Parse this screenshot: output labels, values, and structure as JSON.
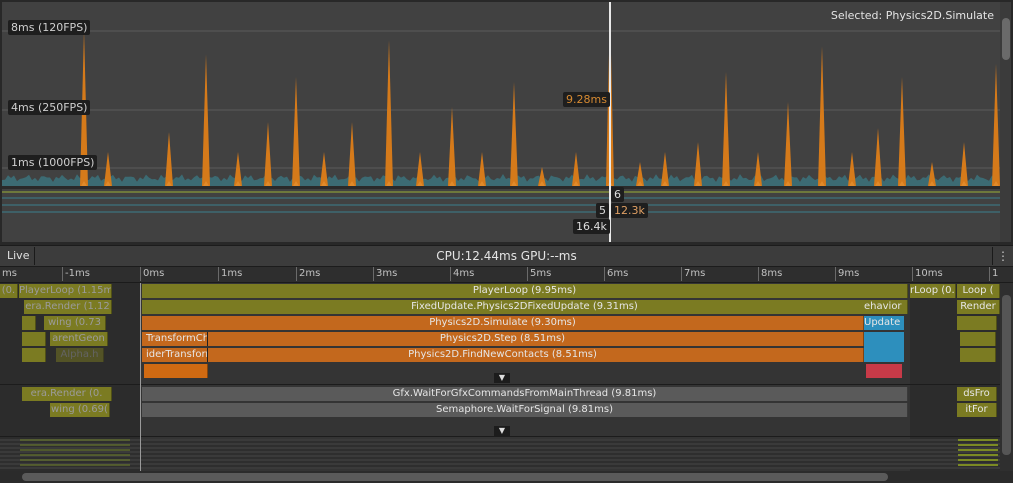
{
  "chart": {
    "selected_label": "Selected: Physics2D.Simulate",
    "fps_markers": [
      {
        "label": "8ms (120FPS)"
      },
      {
        "label": "4ms (250FPS)"
      },
      {
        "label": "1ms (1000FPS)"
      }
    ],
    "cursor_value": "9.28ms",
    "cursor_small_a": "6",
    "cursor_small_b": "5",
    "cursor_value_b": "12.3k",
    "cursor_value_c": "16.4k",
    "colors": {
      "spike": "#d57a1a",
      "baseline": "#3c6b73",
      "cursor": "#e8e8e8"
    }
  },
  "header": {
    "live_label": "Live",
    "cpu_gpu": "CPU:12.44ms   GPU:--ms",
    "menu_icon": "kebab-icon"
  },
  "ruler": {
    "ticks": [
      "ms",
      "-1ms",
      "0ms",
      "1ms",
      "2ms",
      "3ms",
      "4ms",
      "5ms",
      "6ms",
      "7ms",
      "8ms",
      "9ms",
      "10ms",
      "1"
    ]
  },
  "timeline": {
    "main_rows": [
      {
        "label": "PlayerLoop (9.95ms)"
      },
      {
        "label": "FixedUpdate.Physics2DFixedUpdate (9.31ms)"
      },
      {
        "label": "Physics2D.Simulate (9.30ms)"
      },
      {
        "label": "Physics2D.Step (8.51ms)"
      },
      {
        "label": "Physics2D.FindNewContacts (8.51ms)"
      }
    ],
    "left_labels": [
      "(0.",
      "PlayerLoop (1.15ms",
      "era.Render (1.12",
      "wing (0.73",
      "arentGeon",
      "Alpha.h"
    ],
    "right_labels": [
      "rLoop (0.6",
      "Loop (",
      "ehavior",
      "Update",
      "Render",
      "dsFro",
      "itFor"
    ],
    "sub_labels": [
      "TransformCh",
      "iderTransforn"
    ],
    "render_rows": [
      {
        "label": "Gfx.WaitForGfxCommandsFromMainThread (9.81ms)"
      },
      {
        "label": "Semaphore.WaitForSignal (9.81ms)"
      }
    ],
    "render_left": [
      "era.Render (0.",
      "wing (0.69("
    ]
  }
}
